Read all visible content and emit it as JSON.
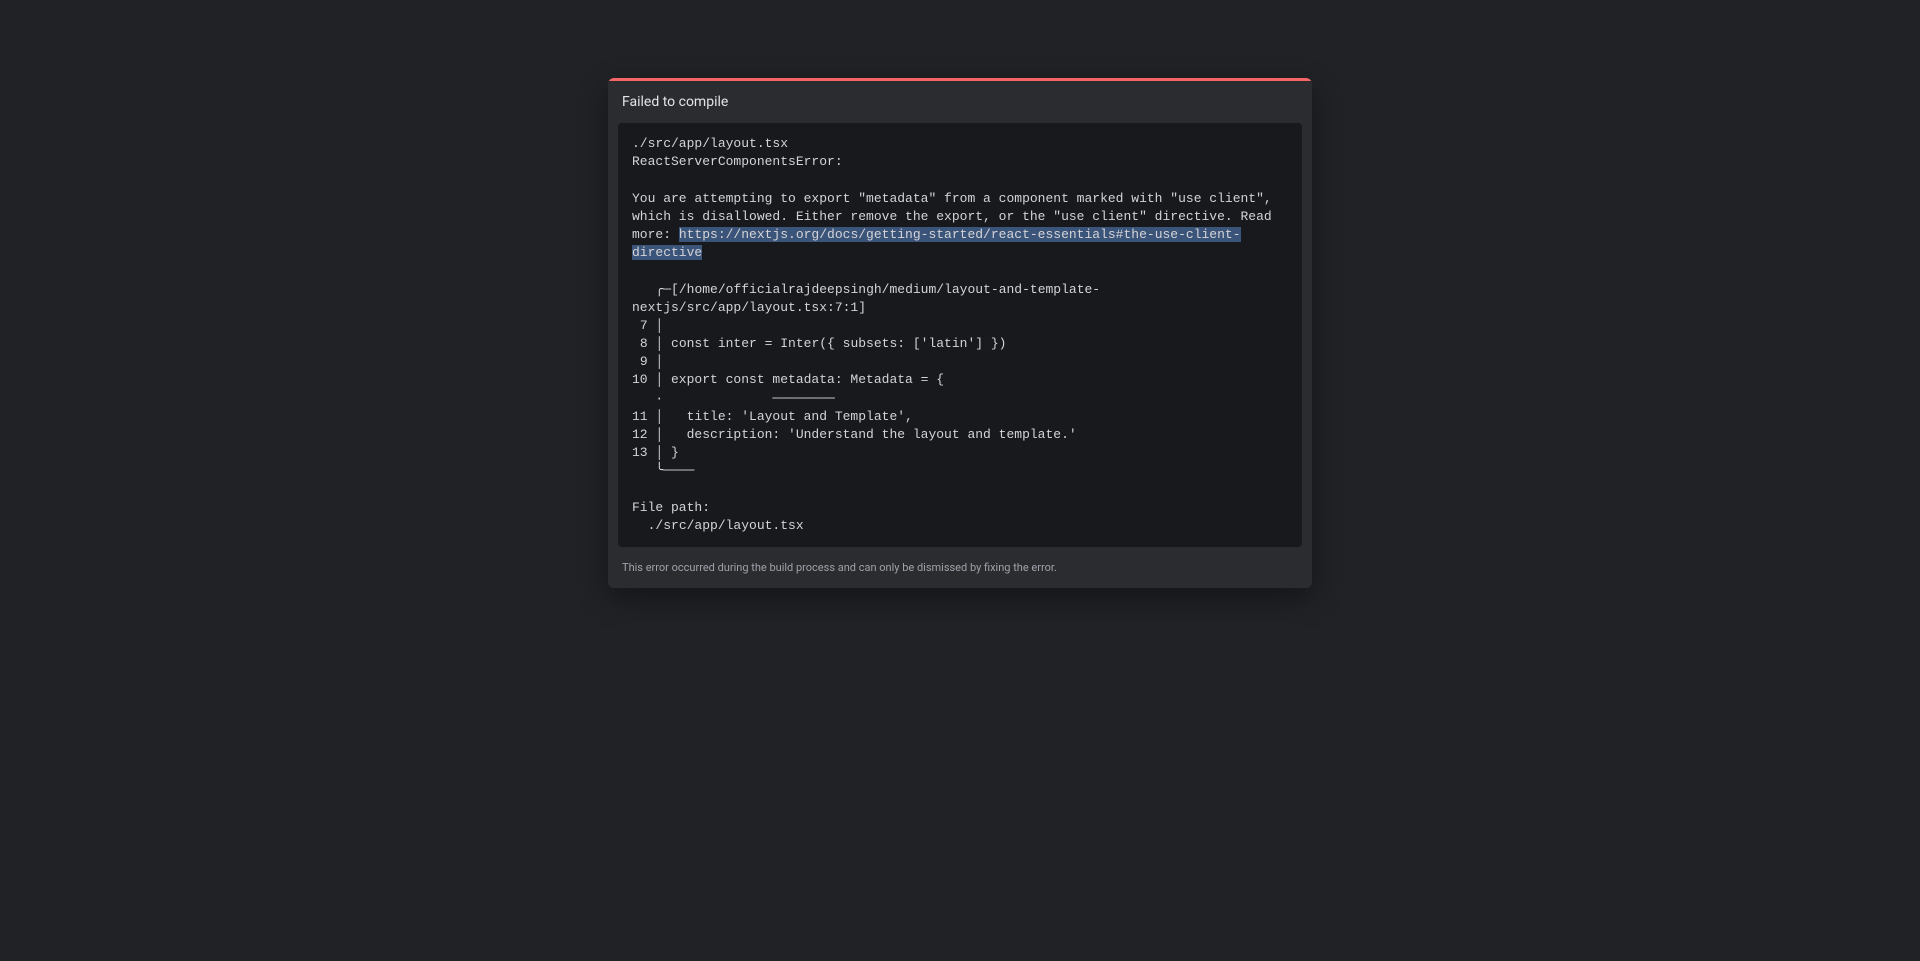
{
  "dialog": {
    "title": "Failed to compile",
    "error_text_before_link": "./src/app/layout.tsx\nReactServerComponentsError:\n\nYou are attempting to export \"metadata\" from a component marked with \"use client\", which is disallowed. Either remove the export, or the \"use client\" directive. Read more: ",
    "error_link": "https://nextjs.org/docs/getting-started/react-essentials#the-use-client-directive",
    "error_text_after_link": "\n\n   ╭─[/home/officialrajdeepsingh/medium/layout-and-template-nextjs/src/app/layout.tsx:7:1]\n 7 │ \n 8 │ const inter = Inter({ subsets: ['latin'] })\n 9 │ \n10 │ export const metadata: Metadata = {\n   ·              ────────\n11 │   title: 'Layout and Template',\n12 │   description: 'Understand the layout and template.'\n13 │ }\n   ╰────\n\nFile path:\n  ./src/app/layout.tsx",
    "footer_text": "This error occurred during the build process and can only be dismissed by fixing the error."
  }
}
